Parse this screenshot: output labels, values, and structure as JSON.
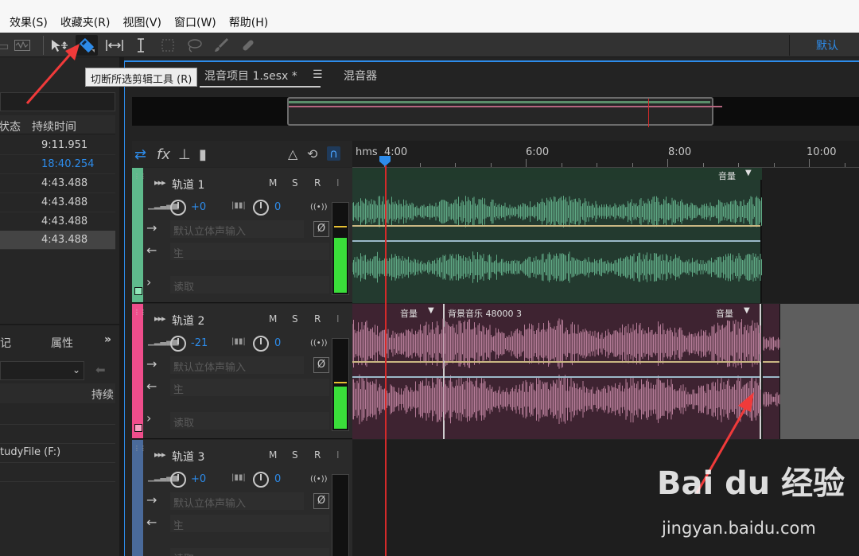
{
  "menu": [
    "效果(S)",
    "收藏夹(R)",
    "视图(V)",
    "窗口(W)",
    "帮助(H)"
  ],
  "toolbar": {
    "workspace": "默认",
    "tooltip": "切断所选剪辑工具 (R)"
  },
  "left_panel": {
    "header_status": "状态",
    "header_duration": "持续时间",
    "durations": [
      "9:11.951",
      "18:40.254",
      "4:43.488",
      "4:43.488",
      "4:43.488",
      "4:43.488"
    ],
    "highlight_color": "#2d8ceb",
    "tab_markers": "记",
    "tab_properties": "属性",
    "duration_label": "持续",
    "drive": "tudyFile (F:)"
  },
  "editor": {
    "tab_title": "混音项目 1.sesx *",
    "tab_mixer": "混音器",
    "ruler": {
      "unit": "hms",
      "labels": [
        "4:00",
        "6:00",
        "8:00",
        "10:00"
      ]
    }
  },
  "tracks": [
    {
      "name": "轨道 1",
      "color": "#5fba8c",
      "volume": "+0",
      "pan": "0",
      "input": "默认立体声输入",
      "output": "主",
      "mode": "读取",
      "clip_label": "音量",
      "m": "M",
      "s": "S",
      "r": "R",
      "i": "I",
      "meter_level": 0.62
    },
    {
      "name": "轨道 2",
      "color": "#ef4d8b",
      "volume": "-21",
      "pan": "0",
      "input": "默认立体声输入",
      "output": "主",
      "mode": "读取",
      "clip_label_a": "音量",
      "clip_label_b": "背景音乐 48000 3",
      "clip_label_c": "音量",
      "m": "M",
      "s": "S",
      "r": "R",
      "i": "I",
      "meter_level": 0.48
    },
    {
      "name": "轨道 3",
      "color": "#4a6a9a",
      "volume": "+0",
      "pan": "0",
      "input": "默认立体声输入",
      "output": "主",
      "mode": "读取",
      "m": "M",
      "s": "S",
      "r": "R",
      "i": "I"
    }
  ],
  "watermark": {
    "brand": "Bai du 经验",
    "url": "jingyan.baidu.com"
  }
}
